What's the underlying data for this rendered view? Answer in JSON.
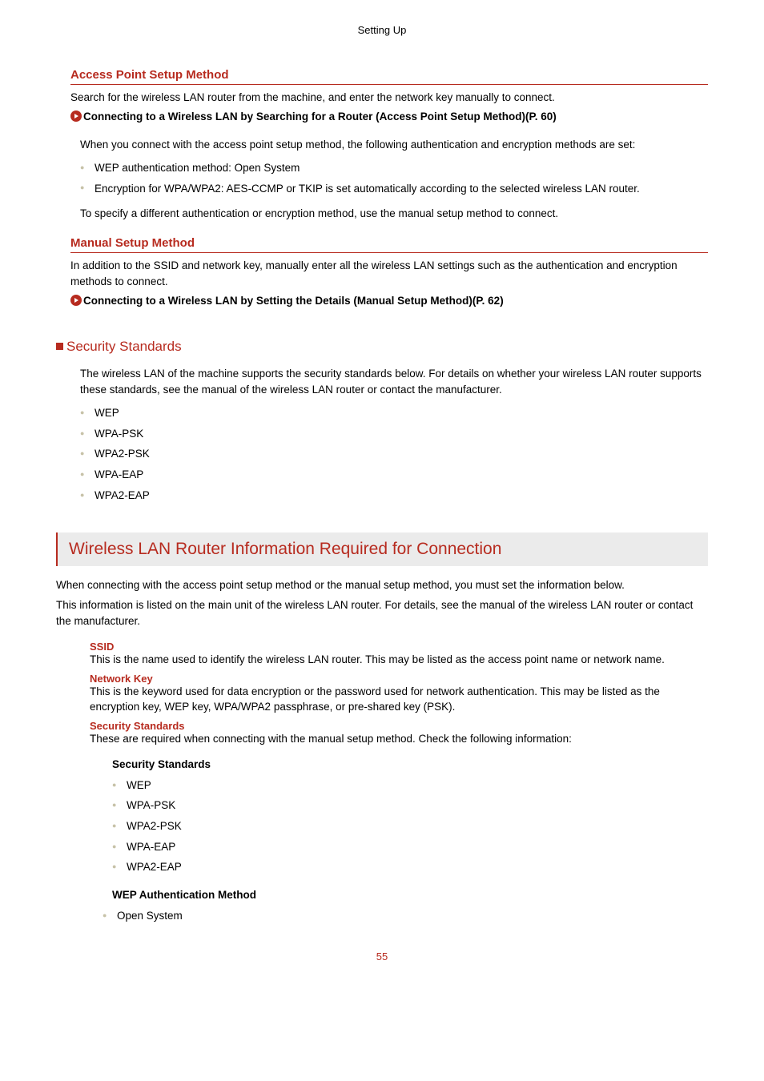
{
  "header": "Setting Up",
  "sec1": {
    "title": "Access Point Setup Method",
    "intro": "Search for the wireless LAN router from the machine, and enter the network key manually to connect.",
    "link": "Connecting to a Wireless LAN by Searching for a Router (Access Point Setup Method)(P. 60)",
    "note_intro": "When you connect with the access point setup method, the following authentication and encryption methods are set:",
    "bullets": [
      "WEP authentication method: Open System",
      "Encryption for WPA/WPA2: AES-CCMP or TKIP is set automatically according to the selected wireless LAN router."
    ],
    "note_out": "To specify a different authentication or encryption method, use the manual setup method to connect."
  },
  "sec2": {
    "title": "Manual Setup Method",
    "intro": "In addition to the SSID and network key, manually enter all the wireless LAN settings such as the authentication and encryption methods to connect.",
    "link": "Connecting to a Wireless LAN by Setting the Details (Manual Setup Method)(P. 62)"
  },
  "sec3": {
    "title": "Security Standards",
    "intro": "The wireless LAN of the machine supports the security standards below. For details on whether your wireless LAN router supports these standards, see the manual of the wireless LAN router or contact the manufacturer.",
    "items": [
      "WEP",
      "WPA-PSK",
      "WPA2-PSK",
      "WPA-EAP",
      "WPA2-EAP"
    ]
  },
  "banner": "Wireless LAN Router Information Required for Connection",
  "banner_intro1": "When connecting with the access point setup method or the manual setup method, you must set the information below.",
  "banner_intro2": "This information is listed on the main unit of the wireless LAN router. For details, see the manual of the wireless LAN router or contact the manufacturer.",
  "defs": {
    "ssid": {
      "t": "SSID",
      "b": "This is the name used to identify the wireless LAN router. This may be listed as the access point name or network name."
    },
    "nkey": {
      "t": "Network Key",
      "b": "This is the keyword used for data encryption or the password used for network authentication. This may be listed as the encryption key, WEP key, WPA/WPA2 passphrase, or pre-shared key (PSK)."
    },
    "sstd": {
      "t": "Security Standards",
      "b": "These are required when connecting with the manual setup method. Check the following information:"
    }
  },
  "sstd_sub": {
    "title": "Security Standards",
    "items": [
      "WEP",
      "WPA-PSK",
      "WPA2-PSK",
      "WPA-EAP",
      "WPA2-EAP"
    ]
  },
  "wep_sub": {
    "title": "WEP Authentication Method",
    "items": [
      "Open System"
    ]
  },
  "page_number": "55"
}
